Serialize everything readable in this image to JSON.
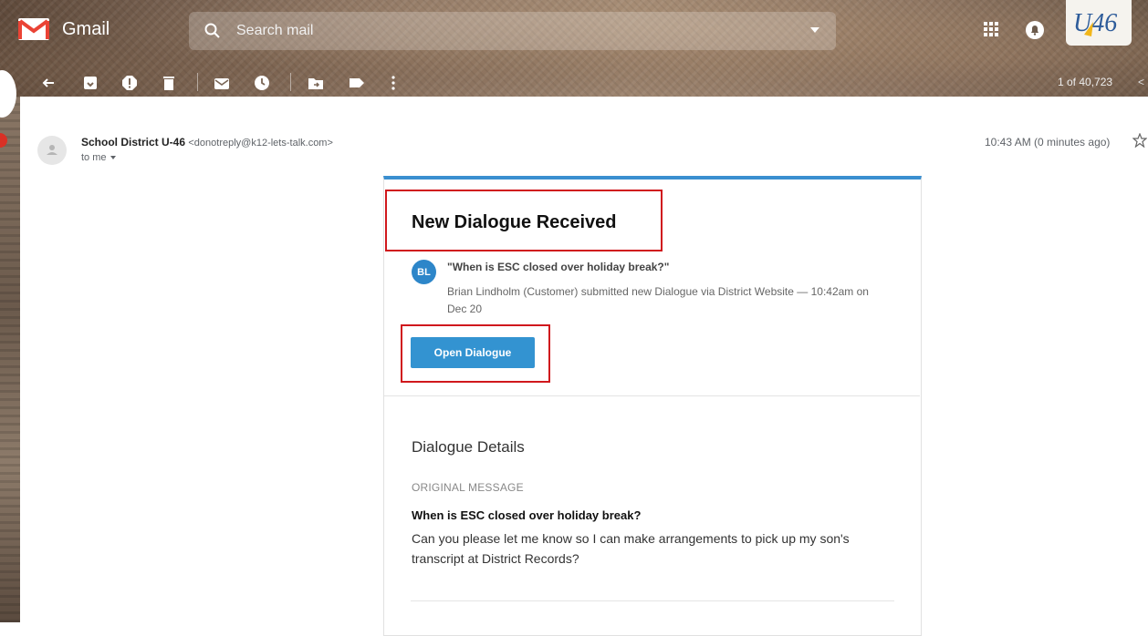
{
  "app": {
    "name": "Gmail"
  },
  "search": {
    "placeholder": "Search mail"
  },
  "pager": {
    "text": "1 of 40,723",
    "prev_glyph": "<"
  },
  "email": {
    "sender_name": "School District U-46",
    "sender_email": "<donotreply@k12-lets-talk.com>",
    "to": "to me",
    "timestamp": "10:43 AM (0 minutes ago)"
  },
  "card": {
    "title": "New Dialogue Received",
    "avatar_initials": "BL",
    "quote": "\"When is ESC closed over holiday break?\"",
    "description": "Brian Lindholm (Customer) submitted new Dialogue via District Website — 10:42am on Dec 20",
    "button_label": "Open Dialogue",
    "details_title": "Dialogue Details",
    "original_label": "ORIGINAL MESSAGE",
    "message_subject": "When is ESC closed over holiday break?",
    "message_body": "Can you please let me know so I can make arrangements to pick up my son's transcript at District Records?"
  },
  "account_logo_text": "U46",
  "colors": {
    "accent_blue": "#3393d1",
    "card_top_border": "#3a8fd0",
    "highlight_red": "#d0181d",
    "gmail_red": "#ea4335"
  },
  "icons": [
    "back-arrow-icon",
    "archive-icon",
    "report-spam-icon",
    "delete-icon",
    "mark-unread-icon",
    "snooze-icon",
    "move-to-icon",
    "label-icon",
    "more-options-icon",
    "search-icon",
    "apps-grid-icon",
    "notifications-icon",
    "star-icon"
  ]
}
